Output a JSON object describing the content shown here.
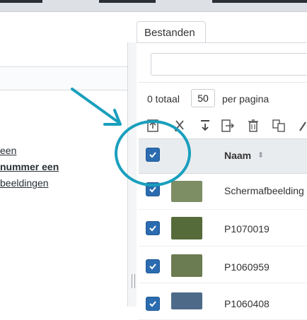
{
  "tab": {
    "label": "Bestanden"
  },
  "left_links": [
    {
      "text": "een",
      "style": "underline"
    },
    {
      "text": "nummer een",
      "style": "bold-underline"
    },
    {
      "text": "beeldingen",
      "style": "underline"
    }
  ],
  "pager": {
    "total": "0 totaal",
    "page_size": "50",
    "per_page": "per pagina"
  },
  "toolbar_icons": [
    "upload-icon",
    "cut-icon",
    "download-icon",
    "export-icon",
    "trash-icon",
    "copy-icon",
    "edit-icon"
  ],
  "grid": {
    "column_name": "Naam",
    "sort_glyph": "⬍",
    "rows": [
      {
        "name": "Schermafbeelding",
        "thumb_color": "#7d8d64"
      },
      {
        "name": "P1070019",
        "thumb_color": "#556b3a"
      },
      {
        "name": "P1060959",
        "thumb_color": "#6b7b52"
      },
      {
        "name": "P1060408",
        "thumb_color": "#4d6a88"
      }
    ]
  },
  "colors": {
    "accent": "#1a9fbd",
    "checkbox": "#2b6cb0"
  }
}
